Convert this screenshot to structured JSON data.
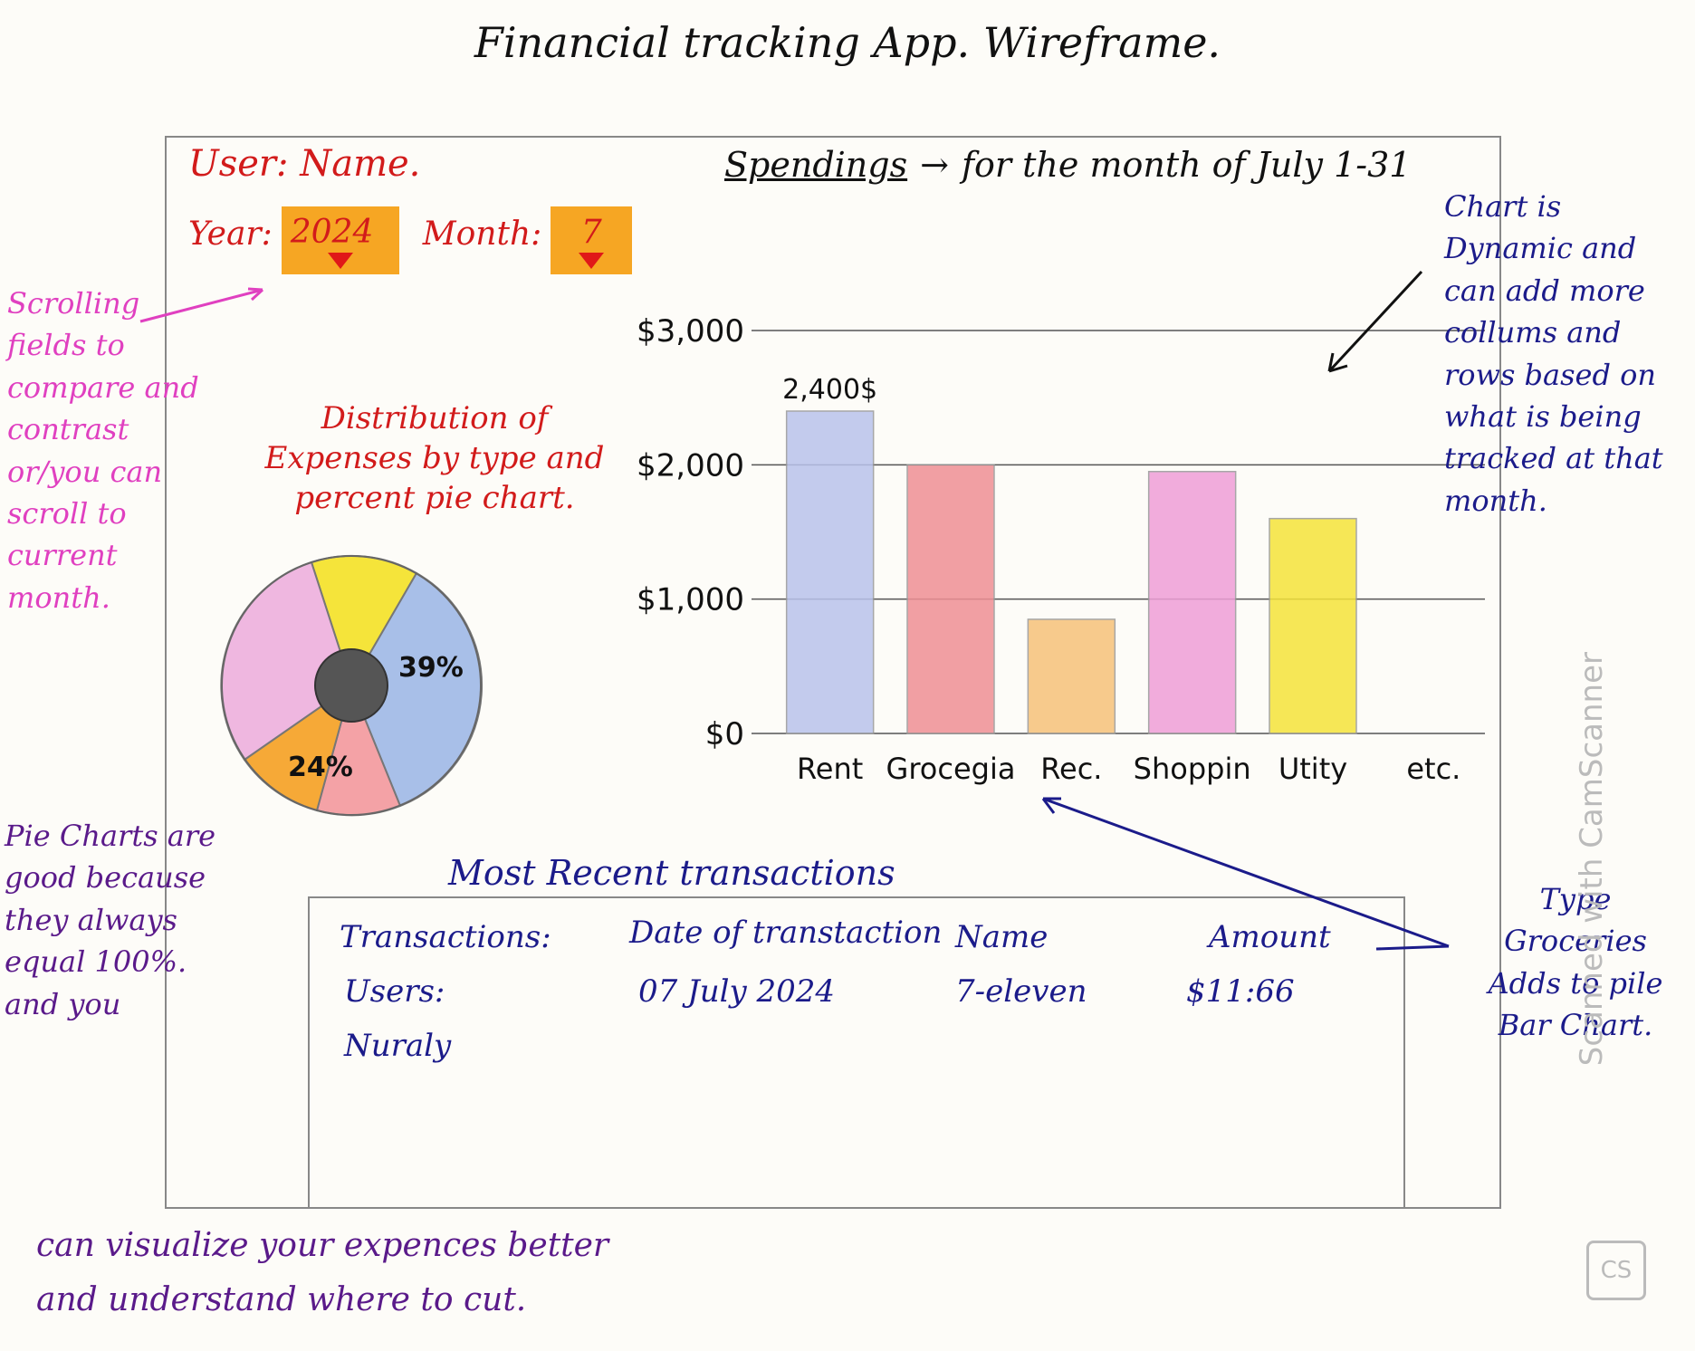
{
  "title": "Financial tracking App. Wireframe.",
  "user": {
    "label": "User: Name."
  },
  "filters": {
    "year_label": "Year:",
    "year_value": "2024",
    "month_label": "Month:",
    "month_value": "7"
  },
  "pie": {
    "caption": "Distribution of Expenses by type and percent pie chart.",
    "labels": [
      "39%",
      "24%"
    ]
  },
  "spendings": {
    "title": "Spendings",
    "subtitle": "for the month of July 1-31"
  },
  "chart_data": {
    "type": "bar",
    "categories": [
      "Rent",
      "Grocegia",
      "Rec.",
      "Shoppin",
      "Utity",
      "etc."
    ],
    "values": [
      2400,
      2000,
      850,
      1950,
      1600,
      null
    ],
    "colors": [
      "#b9c3ec",
      "#f08f95",
      "#f6c27a",
      "#ef9fd8",
      "#f5e43a"
    ],
    "y_ticks": [
      "$0",
      "$1,000",
      "$2,000",
      "$3,000"
    ],
    "ylim": [
      0,
      3000
    ],
    "data_labels": [
      "2,400$"
    ]
  },
  "transactions": {
    "heading": "Most Recent transactions",
    "headers": [
      "Transactions:",
      "Date of transtaction",
      "Name",
      "Amount"
    ],
    "rows": [
      {
        "users_label": "Users:",
        "user_name": "Nuraly",
        "date": "07 July 2024",
        "name": "7-eleven",
        "amount": "$11:66"
      }
    ]
  },
  "annotations": {
    "scrolling": "Scrolling fields to compare and contrast or/you can scroll to current month.",
    "pie_good": "Pie Charts are good because they always equal 100%. and you",
    "bottom_line1": "can visualize your expences better",
    "bottom_line2": "and understand where to cut.",
    "chart_dynamic": "Chart is Dynamic and can add more collums and rows based on what is being tracked at that month.",
    "type_groceries": "Type Groceries Adds to pile Bar Chart."
  },
  "watermark": "Scanned with CamScanner",
  "watermark_badge": "CS",
  "icons": [
    "dropdown-triangle-icon",
    "arrow-icon"
  ]
}
